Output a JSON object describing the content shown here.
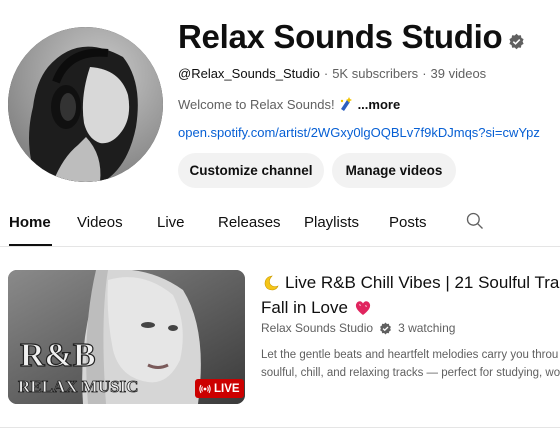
{
  "channel": {
    "name": "Relax Sounds Studio",
    "handle": "@Relax_Sounds_Studio",
    "subscribers": "5K subscribers",
    "videos": "39 videos",
    "description": "Welcome to Relax Sounds!",
    "more_label": "...more",
    "link": "open.spotify.com/artist/2WGxy0lgOQBLv7f9kDJmqs?si=cwYpz"
  },
  "buttons": {
    "customize": "Customize channel",
    "manage": "Manage videos"
  },
  "tabs": [
    {
      "label": "Home",
      "active": true
    },
    {
      "label": "Videos"
    },
    {
      "label": "Live"
    },
    {
      "label": "Releases"
    },
    {
      "label": "Playlists"
    },
    {
      "label": "Posts"
    }
  ],
  "featured": {
    "thumbnail_text_1": "R&B",
    "thumbnail_text_2": "RELAX MUSIC",
    "live_badge": "LIVE",
    "title_line1": "Live R&B Chill Vibes | 21 Soulful Tra",
    "title_line2": "Fall in Love",
    "channel": "Relax Sounds Studio",
    "watching": "3 watching",
    "desc_line1": "Let the gentle beats and heartfelt melodies carry you throu",
    "desc_line2": "soulful, chill, and relaxing tracks — perfect for studying, wo"
  },
  "icons": {
    "verified": "verified-badge-icon",
    "search": "search-icon",
    "moon": "crescent-moon-icon",
    "heart": "sparkling-heart-icon",
    "live": "live-broadcast-icon"
  },
  "colors": {
    "link": "#065fd4",
    "live_red": "#cc0000",
    "button_bg": "#f2f2f2"
  }
}
